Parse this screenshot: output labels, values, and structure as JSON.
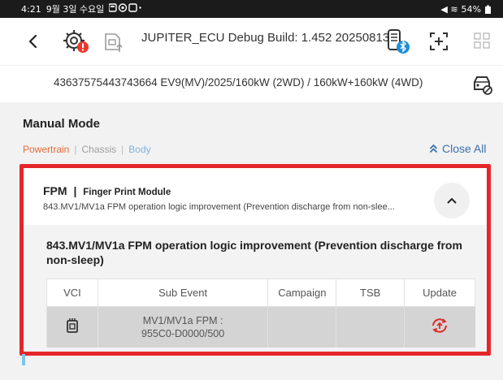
{
  "status_bar": {
    "time": "4:21",
    "date": "9월 3일 수요일",
    "signal": "◀ ≋",
    "battery": "54%"
  },
  "header": {
    "app_title": "JUPITER_ECU Debug Build: 1.452 20250813"
  },
  "vehicle": {
    "info": "43637575443743664  EV9(MV)/2025/160kW (2WD) / 160kW+160kW (4WD)"
  },
  "main": {
    "title": "Manual Mode",
    "categories": {
      "powertrain": "Powertrain",
      "separator": "|",
      "chassis": "Chassis",
      "body": "Body"
    },
    "close_all": "Close All"
  },
  "module": {
    "code": "FPM",
    "separator": "|",
    "name": "Finger Print Module",
    "description": "843.MV1/MV1a FPM operation logic improvement (Prevention discharge from non-slee..."
  },
  "event": {
    "title": "843.MV1/MV1a FPM operation logic improvement (Prevention discharge from non-sleep)",
    "columns": {
      "vci": "VCI",
      "sub_event": "Sub Event",
      "campaign": "Campaign",
      "tsb": "TSB",
      "update": "Update"
    },
    "row": {
      "sub_event_line1": "MV1/MV1a FPM :",
      "sub_event_line2": "955C0-D0000/500",
      "campaign": "",
      "tsb": ""
    }
  },
  "colors": {
    "highlight": "#e4262a",
    "powertrain": "#e26b3a",
    "body": "#7fb2df",
    "accent": "#3b6fa8",
    "update_icon": "#e02a2a"
  }
}
